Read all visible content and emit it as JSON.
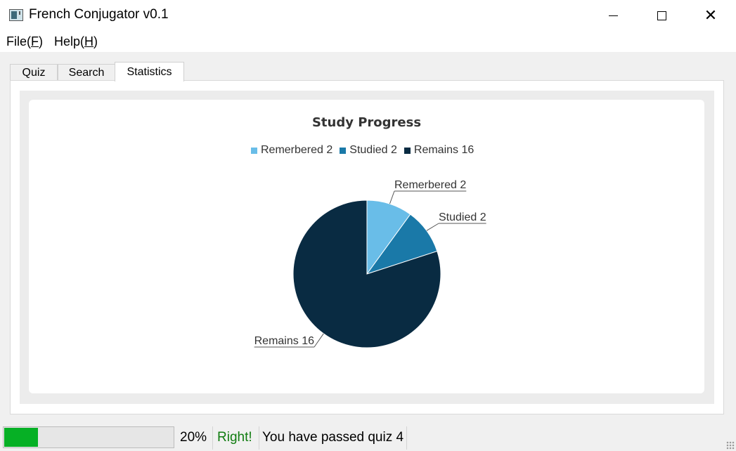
{
  "window": {
    "title": "French Conjugator v0.1",
    "controls": {
      "minimize": "—",
      "maximize": "☐",
      "close": "✕"
    }
  },
  "menu": [
    {
      "label": "File(",
      "mnemonic": "F",
      "suffix": ")"
    },
    {
      "label": "Help(",
      "mnemonic": "H",
      "suffix": ")"
    }
  ],
  "tabs": [
    "Quiz",
    "Search",
    "Statistics"
  ],
  "active_tab": "Statistics",
  "chart_data": {
    "type": "pie",
    "title": "Study Progress",
    "legend_placement": "top",
    "slices": [
      {
        "name": "Remerbered 2",
        "value": 2,
        "color": "#69bde8"
      },
      {
        "name": "Studied 2",
        "value": 2,
        "color": "#1a79a8"
      },
      {
        "name": "Remains 16",
        "value": 16,
        "color": "#092b42"
      }
    ]
  },
  "status": {
    "progress": 0.2,
    "progress_color": "#06b025",
    "percent_label": "20%",
    "result": "Right!",
    "result_color": "#107c10",
    "message": "You have passed quiz 4"
  }
}
